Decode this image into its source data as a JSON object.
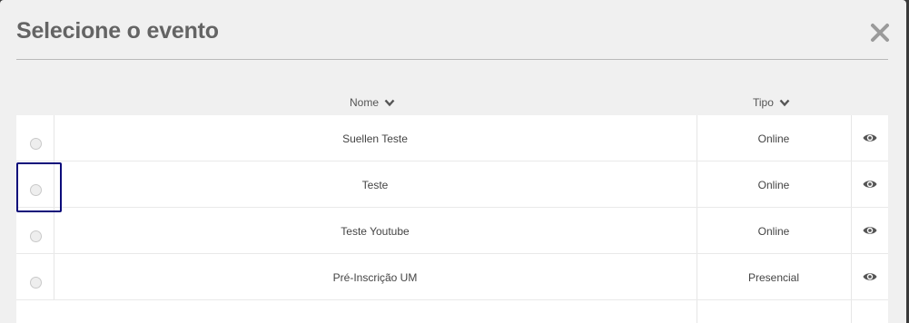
{
  "modal": {
    "title": "Selecione o evento",
    "close_icon": "close-icon"
  },
  "table": {
    "columns": [
      {
        "label": "Nome",
        "sort_icon": "chevron-down-icon"
      },
      {
        "label": "Tipo",
        "sort_icon": "chevron-down-icon"
      }
    ],
    "rows": [
      {
        "nome": "Suellen Teste",
        "tipo": "Online",
        "selected": false,
        "action_icon": "eye-icon"
      },
      {
        "nome": "Teste",
        "tipo": "Online",
        "selected": false,
        "action_icon": "eye-icon"
      },
      {
        "nome": "Teste Youtube",
        "tipo": "Online",
        "selected": false,
        "action_icon": "eye-icon"
      },
      {
        "nome": "Pré-Inscrição UM",
        "tipo": "Presencial",
        "selected": false,
        "action_icon": "eye-icon"
      }
    ]
  },
  "colors": {
    "focus_outline": "#0b0b7a",
    "title_text": "#646464",
    "modal_background": "#f0f0f0"
  }
}
